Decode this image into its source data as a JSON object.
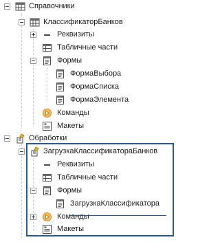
{
  "tree": {
    "spravochniki": {
      "label": "Справочники",
      "icon": "catalog-icon",
      "klassifikator": {
        "label": "КлассификаторБанков",
        "rekvizity": "Реквизиты",
        "tablichnye": "Табличные части",
        "formy": {
          "label": "Формы",
          "items": [
            "ФормаВыбора",
            "ФормаСписка",
            "ФормаЭлемента"
          ]
        },
        "komandy": "Команды",
        "makety": "Макеты"
      }
    },
    "obrabotki": {
      "label": "Обработки",
      "icon": "data-processor-icon",
      "zagruzka": {
        "label": "ЗагрузкаКлассификатораБанков",
        "rekvizity": "Реквизиты",
        "tablichnye": "Табличные части",
        "formy": {
          "label": "Формы",
          "items": [
            "ЗагрузкаКлассификатора"
          ]
        },
        "komandy": "Команды",
        "makety": "Макеты"
      }
    }
  },
  "colors": {
    "highlight_border": "#2a5a8e",
    "table_icon": "#4a4a4a",
    "command_icon": "#e8a13a",
    "processor_icon": "#e0b020"
  }
}
